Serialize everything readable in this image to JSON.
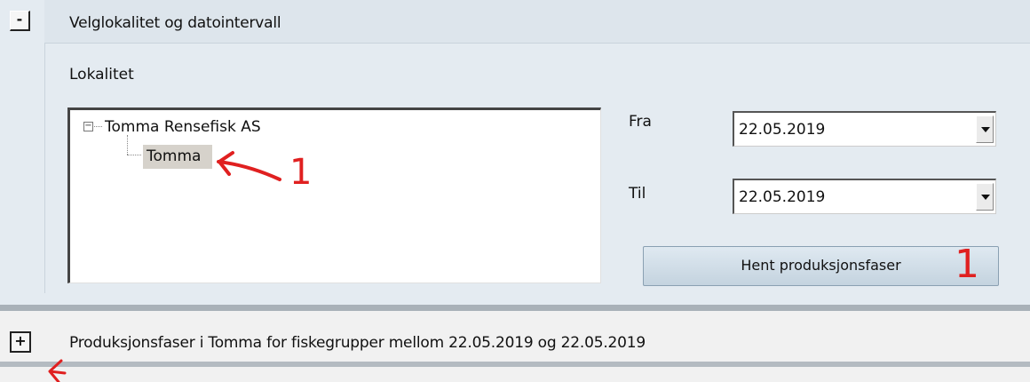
{
  "section1": {
    "toggle_symbol": "-",
    "title": "Velglokalitet og datointervall",
    "lokalitet_label": "Lokalitet",
    "tree": {
      "root_expander": "−",
      "root_label": "Tomma Rensefisk AS",
      "child_label": "Tomma"
    },
    "fra_label": "Fra",
    "fra_value": "22.05.2019",
    "til_label": "Til",
    "til_value": "22.05.2019",
    "hent_button_label": "Hent produksjonsfaser"
  },
  "section2": {
    "toggle_symbol": "+",
    "title": "Produksjonsfaser i Tomma for fiskegrupper mellom 22.05.2019 og 22.05.2019"
  },
  "annotations": {
    "color": "#e02020",
    "marker_1a": "1",
    "marker_1b": "1"
  },
  "colors": {
    "panel_bg": "#e4ebf1",
    "header_bg": "#dde5ec",
    "selection_bg": "#d6d2cb"
  }
}
